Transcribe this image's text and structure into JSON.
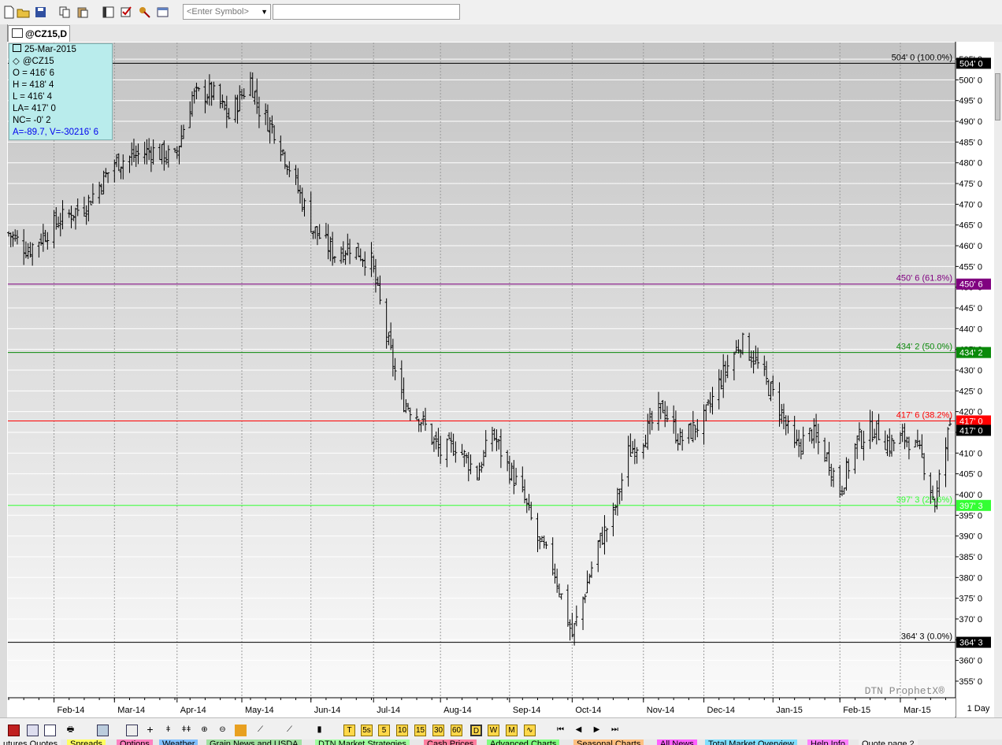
{
  "toolbar": {
    "symbol_placeholder": "<Enter Symbol>",
    "symbol_value": ""
  },
  "chart_tab": {
    "label": "@CZ15,D"
  },
  "ohlc_box": {
    "date": "25-Mar-2015",
    "symbol": "@CZ15",
    "open": "O = 416' 6",
    "high": "H = 418' 4",
    "low": "L = 416' 4",
    "last": "LA= 417' 0",
    "net_change": "NC= -0' 2",
    "extra": "A=-89.7, V=-30216' 6"
  },
  "watermark": "DTN ProphetX®",
  "interval": "1 Day",
  "colors": {
    "fib_100": "#000000",
    "fib_61_8": "#800080",
    "fib_50": "#0a8a0a",
    "fib_38_2": "#ff0000",
    "fib_23_6": "#33ff33",
    "fib_0": "#000000",
    "bars": "#000000",
    "price_badge": "#000000"
  },
  "chart_data": {
    "type": "ohlc",
    "title": "",
    "xlabel": "",
    "ylabel": "",
    "ylim": [
      351,
      509
    ],
    "y_ticks": [
      {
        "v": 355,
        "label": "355' 0"
      },
      {
        "v": 360,
        "label": "360' 0"
      },
      {
        "v": 365,
        "label": "365' 0"
      },
      {
        "v": 370,
        "label": "370' 0"
      },
      {
        "v": 375,
        "label": "375' 0"
      },
      {
        "v": 380,
        "label": "380' 0"
      },
      {
        "v": 385,
        "label": "385' 0"
      },
      {
        "v": 390,
        "label": "390' 0"
      },
      {
        "v": 395,
        "label": "395' 0"
      },
      {
        "v": 400,
        "label": "400' 0"
      },
      {
        "v": 405,
        "label": "405' 0"
      },
      {
        "v": 410,
        "label": "410' 0"
      },
      {
        "v": 415,
        "label": "415' 0"
      },
      {
        "v": 420,
        "label": "420' 0"
      },
      {
        "v": 425,
        "label": "425' 0"
      },
      {
        "v": 430,
        "label": "430' 0"
      },
      {
        "v": 435,
        "label": "435' 0"
      },
      {
        "v": 440,
        "label": "440' 0"
      },
      {
        "v": 445,
        "label": "445' 0"
      },
      {
        "v": 450,
        "label": "450' 0"
      },
      {
        "v": 455,
        "label": "455' 0"
      },
      {
        "v": 460,
        "label": "460' 0"
      },
      {
        "v": 465,
        "label": "465' 0"
      },
      {
        "v": 470,
        "label": "470' 0"
      },
      {
        "v": 475,
        "label": "475' 0"
      },
      {
        "v": 480,
        "label": "480' 0"
      },
      {
        "v": 485,
        "label": "485' 0"
      },
      {
        "v": 490,
        "label": "490' 0"
      },
      {
        "v": 495,
        "label": "495' 0"
      },
      {
        "v": 500,
        "label": "500' 0"
      },
      {
        "v": 505,
        "label": "505' 0"
      }
    ],
    "x_labels": [
      {
        "date": "2014-02-03",
        "label": "Feb-14"
      },
      {
        "date": "2014-03-03",
        "label": "Mar-14"
      },
      {
        "date": "2014-04-01",
        "label": "Apr-14"
      },
      {
        "date": "2014-05-01",
        "label": "May-14"
      },
      {
        "date": "2014-06-02",
        "label": "Jun-14"
      },
      {
        "date": "2014-07-01",
        "label": "Jul-14"
      },
      {
        "date": "2014-08-01",
        "label": "Aug-14"
      },
      {
        "date": "2014-09-02",
        "label": "Sep-14"
      },
      {
        "date": "2014-10-01",
        "label": "Oct-14"
      },
      {
        "date": "2014-11-03",
        "label": "Nov-14"
      },
      {
        "date": "2014-12-01",
        "label": "Dec-14"
      },
      {
        "date": "2015-01-02",
        "label": "Jan-15"
      },
      {
        "date": "2015-02-02",
        "label": "Feb-15"
      },
      {
        "date": "2015-03-02",
        "label": "Mar-15"
      }
    ],
    "x_range": [
      "2014-01-13",
      "2015-03-25"
    ],
    "fib_levels": [
      {
        "value": 504.0,
        "label": "504' 0 (100.0%)",
        "badge": "504' 0",
        "color": "#000000"
      },
      {
        "value": 450.75,
        "label": "450' 6 (61.8%)",
        "badge": "450' 6",
        "color": "#800080"
      },
      {
        "value": 434.25,
        "label": "434' 2 (50.0%)",
        "badge": "434' 2",
        "color": "#0a8a0a"
      },
      {
        "value": 417.75,
        "label": "417' 6 (38.2%)",
        "badge": "417' 0",
        "color": "#ff0000"
      },
      {
        "value": 397.375,
        "label": "397' 3 (23.6%)",
        "badge": "397' 3",
        "color": "#33ff33"
      },
      {
        "value": 364.375,
        "label": "364' 3 (0.0%)",
        "badge": "364' 3",
        "color": "#000000"
      }
    ],
    "last_price": {
      "value": 417.0,
      "label": "417' 0"
    },
    "price_path": [
      [
        "2014-01-13",
        463
      ],
      [
        "2014-01-22",
        459
      ],
      [
        "2014-02-05",
        466
      ],
      [
        "2014-02-18",
        470
      ],
      [
        "2014-03-03",
        480
      ],
      [
        "2014-03-20",
        483
      ],
      [
        "2014-03-31",
        481
      ],
      [
        "2014-04-08",
        496
      ],
      [
        "2014-04-17",
        497
      ],
      [
        "2014-04-25",
        491
      ],
      [
        "2014-05-05",
        500
      ],
      [
        "2014-05-09",
        493
      ],
      [
        "2014-05-16",
        488
      ],
      [
        "2014-05-23",
        479
      ],
      [
        "2014-06-03",
        464
      ],
      [
        "2014-06-13",
        458
      ],
      [
        "2014-06-20",
        460
      ],
      [
        "2014-06-30",
        456
      ],
      [
        "2014-07-08",
        436
      ],
      [
        "2014-07-14",
        423
      ],
      [
        "2014-07-22",
        419
      ],
      [
        "2014-08-01",
        410
      ],
      [
        "2014-08-08",
        412
      ],
      [
        "2014-08-18",
        405
      ],
      [
        "2014-08-25",
        415
      ],
      [
        "2014-09-01",
        407
      ],
      [
        "2014-09-08",
        400
      ],
      [
        "2014-09-15",
        389
      ],
      [
        "2014-09-22",
        383
      ],
      [
        "2014-10-01",
        366
      ],
      [
        "2014-10-06",
        375
      ],
      [
        "2014-10-13",
        388
      ],
      [
        "2014-10-20",
        395
      ],
      [
        "2014-10-27",
        410
      ],
      [
        "2014-11-03",
        414
      ],
      [
        "2014-11-12",
        421
      ],
      [
        "2014-11-20",
        413
      ],
      [
        "2014-12-01",
        418
      ],
      [
        "2014-12-09",
        428
      ],
      [
        "2014-12-18",
        437
      ],
      [
        "2014-12-24",
        433
      ],
      [
        "2015-01-05",
        421
      ],
      [
        "2015-01-12",
        411
      ],
      [
        "2015-01-20",
        415
      ],
      [
        "2015-01-28",
        408
      ],
      [
        "2015-02-02",
        401
      ],
      [
        "2015-02-10",
        413
      ],
      [
        "2015-02-18",
        416
      ],
      [
        "2015-02-25",
        412
      ],
      [
        "2015-03-05",
        414
      ],
      [
        "2015-03-12",
        409
      ],
      [
        "2015-03-18",
        398
      ],
      [
        "2015-03-25",
        417
      ]
    ],
    "last_bar": {
      "date": "2015-03-25",
      "open": 416.75,
      "high": 418.5,
      "low": 416.5,
      "close": 417.0
    }
  }
}
